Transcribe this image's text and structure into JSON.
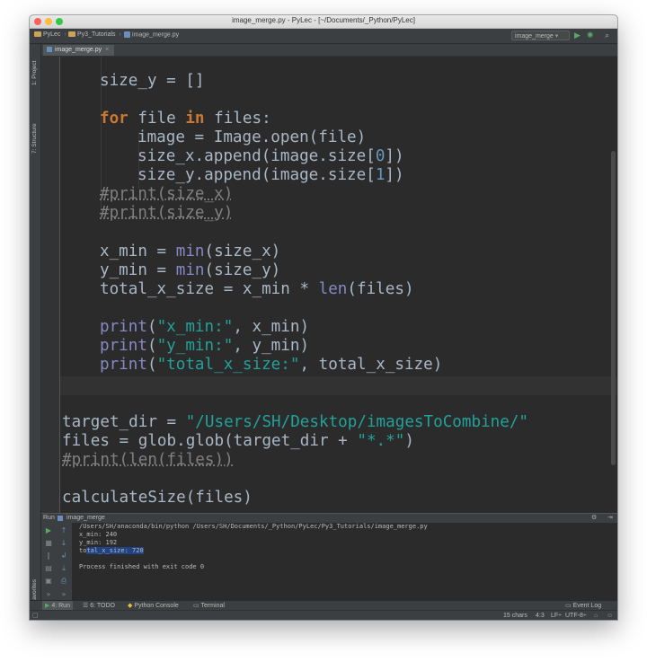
{
  "window": {
    "title": "image_merge.py - PyLec - [~/Documents/_Python/PyLec]"
  },
  "nav": {
    "crumbs": [
      "PyLec",
      "Py3_Tutorials",
      "image_merge.py"
    ],
    "run_config": "image_merge"
  },
  "left_strip": {
    "project": "1: Project",
    "structure": "7: Structure",
    "favorites": "2: Favorites"
  },
  "editor": {
    "tab": "image_merge.py",
    "code": {
      "l1": "size_y = []",
      "for_kw": "for",
      "for_a": " file ",
      "in_kw": "in",
      "for_b": " files:",
      "l3": "image = Image.open(file)",
      "l4a": "size_x.append(image.size[",
      "l4n": "0",
      "l4b": "])",
      "l5a": "size_y.append(image.size[",
      "l5n": "1",
      "l5b": "])",
      "c1": "#print(size_x)",
      "c2": "#print(size_y)",
      "xmin_a": "x_min = ",
      "xmin_f": "min",
      "xmin_b": "(size_x)",
      "ymin_a": "y_min = ",
      "ymin_f": "min",
      "ymin_b": "(size_y)",
      "tot_a": "total_x_size = x_min * ",
      "tot_f": "len",
      "tot_b": "(files)",
      "p1_f": "print",
      "p1_o": "(",
      "p1_s": "\"x_min:\"",
      "p1_b": ", x_min)",
      "p2_f": "print",
      "p2_o": "(",
      "p2_s": "\"y_min:\"",
      "p2_b": ", y_min)",
      "p3_f": "print",
      "p3_o": "(",
      "p3_s": "\"total_x_size:\"",
      "p3_b": ", total_x_size)",
      "td_a": "target_dir = ",
      "td_s": "\"/Users/SH/Desktop/imagesToCombine/\"",
      "fl_a": "files = glob.glob(target_dir + ",
      "fl_s": "\"*.*\"",
      "fl_b": ")",
      "c3": "#print(len(files))",
      "call": "calculateSize(files)"
    }
  },
  "run": {
    "label": "Run",
    "config": "image_merge",
    "output": {
      "cmd": "/Users/SH/anaconda/bin/python /Users/SH/Documents/_Python/PyLec/Py3_Tutorials/image_merge.py",
      "o1": "x_min: 240",
      "o2": "y_min: 192",
      "o3a": "to",
      "o3b": "tal_x_size: 720",
      "done": "Process finished with exit code 0"
    }
  },
  "bottom_tabs": {
    "run": "4: Run",
    "todo": "6: TODO",
    "console": "Python Console",
    "terminal": "Terminal",
    "event_log": "Event Log"
  },
  "status": {
    "chars": "15 chars",
    "pos": "4:3",
    "lf": "LF÷",
    "enc": "UTF-8÷"
  }
}
